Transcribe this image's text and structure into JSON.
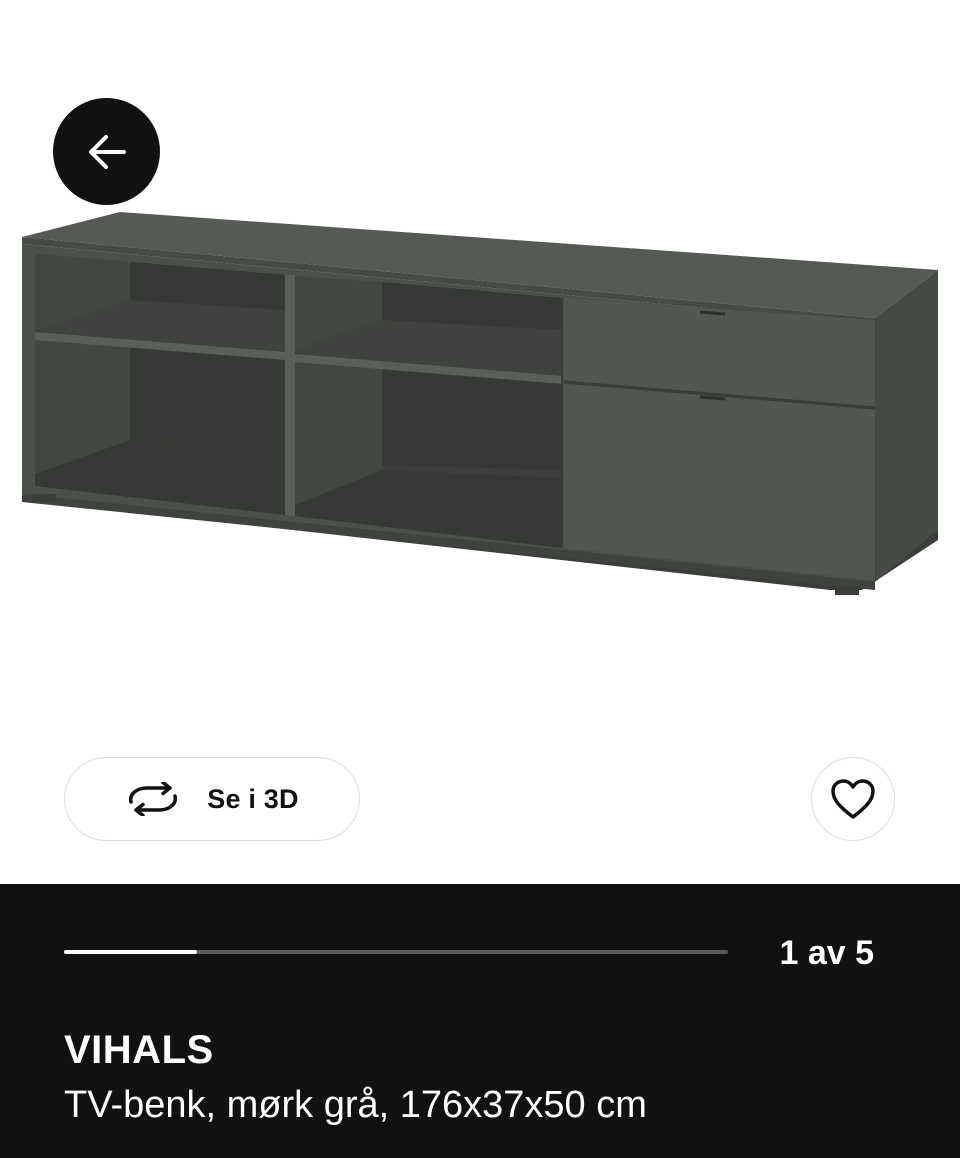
{
  "navigation": {
    "back_icon": "arrow-left-icon"
  },
  "media": {
    "view3d_label": "Se i 3D",
    "view3d_icon": "rotate-3d-icon",
    "favorite_icon": "heart-outline-icon",
    "furniture_color": "#4c504b"
  },
  "carousel": {
    "indicator": "1 av 5",
    "current": 1,
    "total": 5,
    "progress_fraction": 0.2
  },
  "product": {
    "name": "VIHALS",
    "description": "TV-benk, mørk grå, 176x37x50 cm"
  },
  "colors": {
    "panel_background": "#111111",
    "progress_track": "#5a5a5a",
    "progress_fill": "#ffffff"
  }
}
